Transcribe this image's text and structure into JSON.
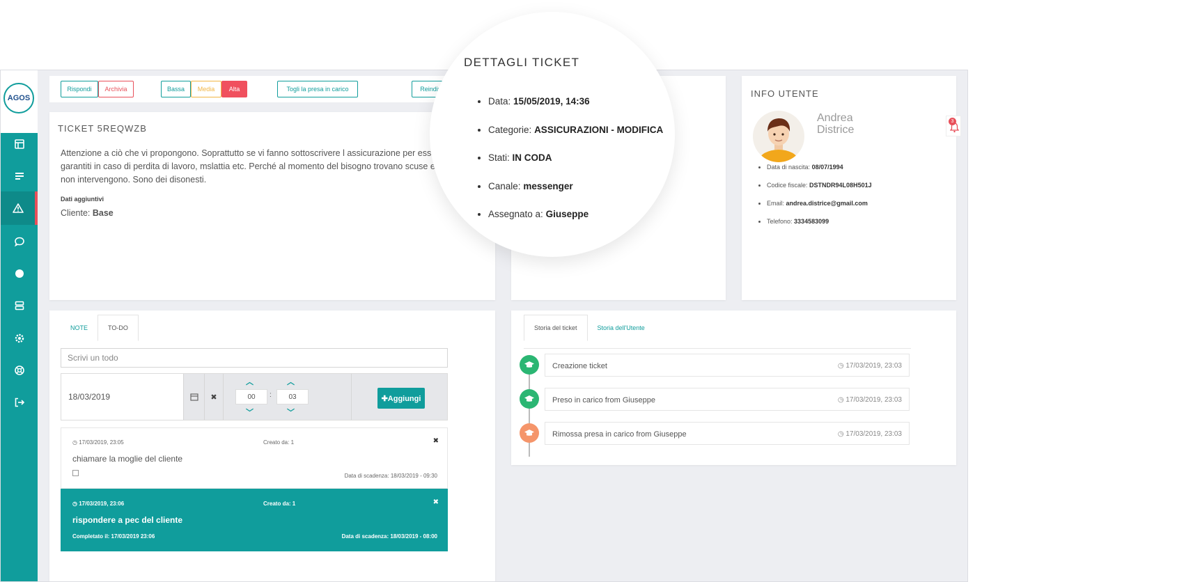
{
  "logo_text": "AGOS",
  "sidebar": {
    "items": [
      {
        "icon": "dashboard-icon"
      },
      {
        "icon": "list-icon"
      },
      {
        "icon": "warning-icon",
        "active": true
      },
      {
        "icon": "chat-icon"
      },
      {
        "icon": "circle-icon"
      },
      {
        "icon": "database-icon"
      },
      {
        "icon": "gear-icon"
      },
      {
        "icon": "help-icon"
      },
      {
        "icon": "logout-icon"
      }
    ]
  },
  "toolbar": {
    "rispondi": "Rispondi",
    "archivia": "Archivia",
    "bassa": "Bassa",
    "media": "Media",
    "alta": "Alta",
    "togli": "Togli la presa in carico",
    "reindirizza": "Reindirizza ▾"
  },
  "ticket": {
    "title": "TICKET 5REQWZB",
    "body": "Attenzione a ciò che vi propongono. Soprattutto se vi fanno sottoscrivere l assicurazione per essere garantiti in caso di perdita di lavoro, mslattia etc. Perché al momento del bisogno trovano scuse e non intervengono. Sono dei disonesti.",
    "extra_label": "Dati aggiuntivi",
    "client_label": "Cliente:",
    "client_value": "Base"
  },
  "details": {
    "title": "DETTAGLI TICKET",
    "rows": [
      {
        "label": "Data:",
        "value": "15/05/2019, 14:36"
      },
      {
        "label": "Categorie:",
        "value": "ASSICURAZIONI - MODIFICA"
      },
      {
        "label": "Stati:",
        "value": "IN CODA"
      },
      {
        "label": "Canale:",
        "value": "messenger"
      },
      {
        "label": "Assegnato a:",
        "value": "Giuseppe"
      }
    ]
  },
  "user": {
    "title": "INFO UTENTE",
    "first_name": "Andrea",
    "last_name": "Districe",
    "rows": [
      {
        "label": "Data di nascita:",
        "value": "08/07/1994"
      },
      {
        "label": "Codice fiscale:",
        "value": "DSTNDR94L08H501J"
      },
      {
        "label": "Email:",
        "value": "andrea.districe@gmail.com"
      },
      {
        "label": "Telefono:",
        "value": "3334583099"
      }
    ]
  },
  "notifications": {
    "count": "3"
  },
  "notes": {
    "tabs": [
      "NOTE",
      "TO-DO"
    ],
    "todo_placeholder": "Scrivi un todo",
    "date_value": "18/03/2019",
    "clear_symbol": "✖",
    "hour": "00",
    "minute": "03",
    "time_sep": ":",
    "add_label": "✚Aggiungi",
    "todos": [
      {
        "created": "17/03/2019, 23:05",
        "creator_label": "Creato da: 1",
        "text": "chiamare la moglie del cliente",
        "due": "Data di scadenza: 18/03/2019 - 09:30",
        "done": false,
        "close": "✖"
      },
      {
        "created": "17/03/2019, 23:06",
        "creator_label": "Creato da: 1",
        "text": "rispondere a pec del cliente",
        "completed": "Completato il: 17/03/2019 23:06",
        "due": "Data di scadenza: 18/03/2019 - 08:00",
        "done": true,
        "close": "✖"
      }
    ]
  },
  "history": {
    "tabs": [
      "Storia del ticket",
      "Storia dell'Utente"
    ],
    "items": [
      {
        "text": "Creazione ticket",
        "date": "17/03/2019, 23:03",
        "color": "#2bb673"
      },
      {
        "text": "Preso in carico from Giuseppe",
        "date": "17/03/2019, 23:03",
        "color": "#2bb673"
      },
      {
        "text": "Rimossa presa in carico from Giuseppe",
        "date": "17/03/2019, 23:03",
        "color": "#f5956a"
      }
    ]
  },
  "colors": {
    "accent": "#109d9c",
    "danger": "#e8505a",
    "warning": "#f2b544"
  }
}
